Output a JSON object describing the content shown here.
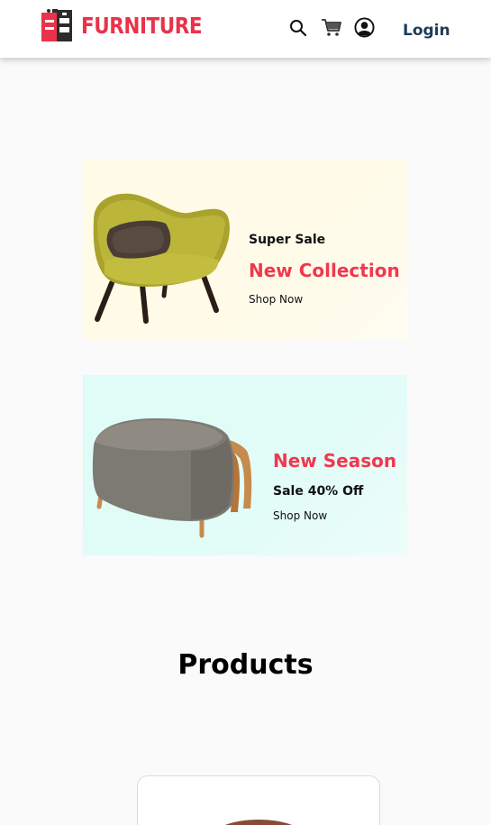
{
  "navbar": {
    "brand": "FURNITURE",
    "login_label": "Login",
    "icons": [
      "search-icon",
      "cart-icon",
      "user-icon"
    ],
    "brand_color": "#e8334a"
  },
  "banners": [
    {
      "subtitle": "Super Sale",
      "title": "New Collection",
      "link": "Shop Now",
      "background": "#fffbe6",
      "image": "armchair"
    },
    {
      "title": "New Season",
      "subtitle": "Sale 40% Off",
      "link": "Shop Now",
      "background": "#dffcf6",
      "image": "ottoman"
    }
  ],
  "products": {
    "heading": "Products"
  },
  "colors": {
    "accent": "#f0384f",
    "login_text": "#1e3d5a"
  }
}
